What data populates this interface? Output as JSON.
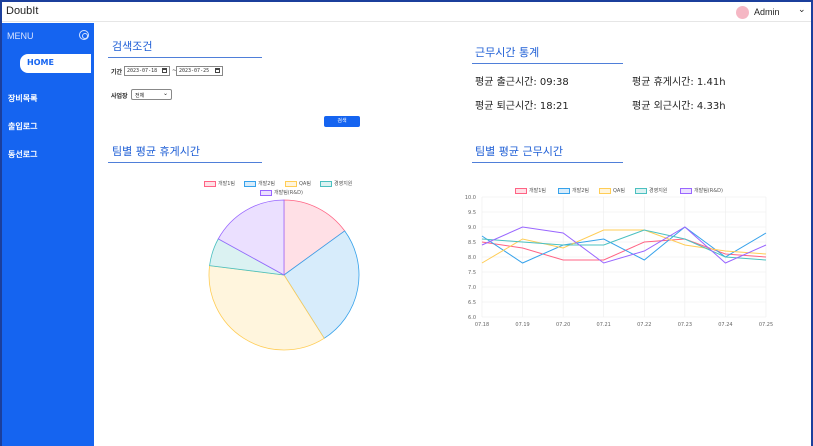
{
  "app": {
    "title": "DoubIt"
  },
  "user": {
    "name": "Admin",
    "chevron": "chevron-down-icon"
  },
  "sidebar": {
    "menu_label": "MENU",
    "toggle_icon": "circle-toggle-icon",
    "items": [
      {
        "label": "HOME",
        "active": true
      },
      {
        "label": "장비목록",
        "active": false
      },
      {
        "label": "출입로그",
        "active": false
      },
      {
        "label": "동선로그",
        "active": false
      }
    ]
  },
  "search": {
    "title": "검색조건",
    "period_label": "기간",
    "start_date": "2023-07-18",
    "end_date": "2023-07-25",
    "separator": "~",
    "site_label": "사업장",
    "site_selected": "전체",
    "search_button": "검색"
  },
  "stats": {
    "title": "근무시간 통계",
    "avg_start": "평균 출근시간: 09:38",
    "avg_break": "평균 휴게시간: 1.41h",
    "avg_end": "평균 퇴근시간: 18:21",
    "avg_outside": "평균 외근시간: 4.33h"
  },
  "colors": {
    "primary": "#1564f0",
    "team_stroke": [
      "#ff6384",
      "#36a2eb",
      "#ffcd56",
      "#4bc0c0",
      "#9966ff"
    ],
    "team_fill": [
      "#ffe0e6",
      "#d7ecfb",
      "#fff5dd",
      "#dbf2f2",
      "#ebe0ff"
    ]
  },
  "pie_section": {
    "title": "팀별 평균 휴게시간"
  },
  "line_section": {
    "title": "팀별 평균 근무시간"
  },
  "chart_data": [
    {
      "type": "pie",
      "title": "팀별 평균 휴게시간",
      "legend_position": "top",
      "labels": [
        "개발1팀",
        "개발2팀",
        "QA팀",
        "경영지원",
        "개발팀(R&D)"
      ],
      "values": [
        15,
        26,
        36,
        6,
        17
      ]
    },
    {
      "type": "line",
      "title": "팀별 평균 근무시간",
      "legend_position": "top",
      "grid": true,
      "x": [
        "07.18",
        "07.19",
        "07.20",
        "07.21",
        "07.22",
        "07.23",
        "07.24",
        "07.25"
      ],
      "ylim": [
        6.0,
        10.0
      ],
      "yticks": [
        "6.0",
        "6.5",
        "7.0",
        "7.5",
        "8.0",
        "8.5",
        "9.0",
        "9.5",
        "10.0"
      ],
      "series": [
        {
          "name": "개발1팀",
          "values": [
            8.5,
            8.3,
            7.9,
            7.9,
            8.5,
            8.6,
            8.1,
            8.0
          ]
        },
        {
          "name": "개발2팀",
          "values": [
            8.7,
            7.8,
            8.4,
            8.6,
            7.9,
            9.0,
            8.0,
            8.8
          ]
        },
        {
          "name": "QA팀",
          "values": [
            7.8,
            8.6,
            8.3,
            8.9,
            8.9,
            8.4,
            8.2,
            8.1
          ]
        },
        {
          "name": "경영지원",
          "values": [
            8.6,
            8.5,
            8.4,
            8.4,
            8.9,
            8.6,
            8.0,
            7.9
          ]
        },
        {
          "name": "개발팀(R&D)",
          "values": [
            8.4,
            9.0,
            8.8,
            7.8,
            8.2,
            9.0,
            7.8,
            8.4
          ]
        }
      ]
    }
  ]
}
